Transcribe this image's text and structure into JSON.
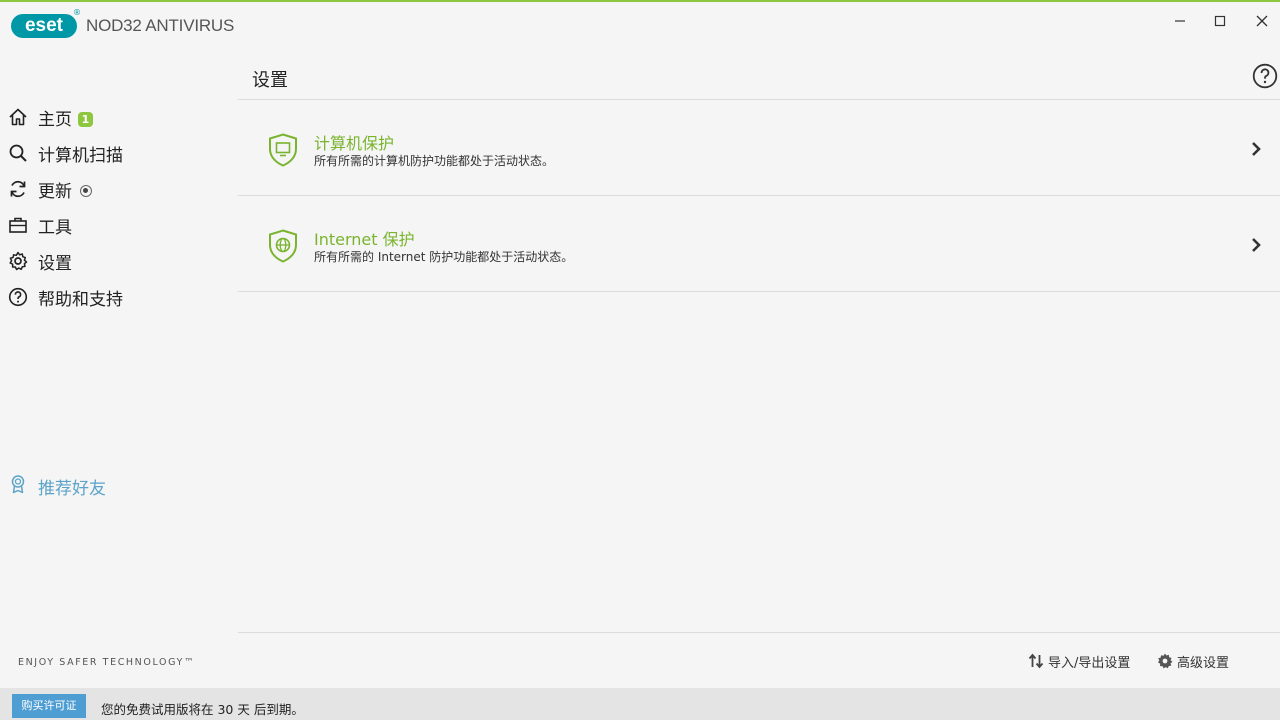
{
  "app": {
    "logo_text": "eset",
    "logo_reg": "®",
    "product_name": "NOD32 ANTIVIRUS",
    "brand_green": "#8dc63f",
    "brand_teal": "#0098a6"
  },
  "window_controls": {
    "minimize_icon": "minimize-icon",
    "maximize_icon": "maximize-icon",
    "close_icon": "close-icon"
  },
  "sidebar": {
    "items": [
      {
        "label": "主页",
        "icon": "home-icon",
        "badge": "1"
      },
      {
        "label": "计算机扫描",
        "icon": "search-icon"
      },
      {
        "label": "更新",
        "icon": "refresh-icon",
        "status": "radio-indicator"
      },
      {
        "label": "工具",
        "icon": "briefcase-icon"
      },
      {
        "label": "设置",
        "icon": "gear-icon",
        "active": true
      },
      {
        "label": "帮助和支持",
        "icon": "help-icon"
      }
    ],
    "referral": {
      "label": "推荐好友",
      "icon": "award-icon",
      "color": "#5ba3c9"
    },
    "slogan": "ENJOY SAFER TECHNOLOGY™"
  },
  "main": {
    "title": "设置",
    "rows": [
      {
        "title": "计算机保护",
        "desc": "所有所需的计算机防护功能都处于活动状态。",
        "icon": "shield-monitor-icon"
      },
      {
        "title": "Internet 保护",
        "desc": "所有所需的 Internet 防护功能都处于活动状态。",
        "icon": "shield-globe-icon"
      }
    ],
    "footer": {
      "import_export": "导入/导出设置",
      "advanced": "高级设置"
    }
  },
  "statusbar": {
    "buy_label": "购买许可证",
    "trial_text": "您的免费试用版将在 30 天 后到期。"
  }
}
